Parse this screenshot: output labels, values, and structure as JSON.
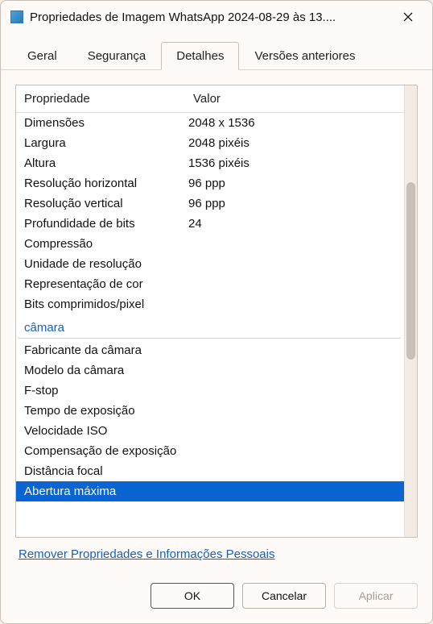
{
  "window": {
    "title": "Propriedades de Imagem WhatsApp 2024-08-29 às 13...."
  },
  "tabs": {
    "items": [
      {
        "label": "Geral"
      },
      {
        "label": "Segurança"
      },
      {
        "label": "Detalhes"
      },
      {
        "label": "Versões anteriores"
      }
    ],
    "active_index": 2
  },
  "grid": {
    "headers": {
      "property": "Propriedade",
      "value": "Valor"
    },
    "rows": [
      {
        "type": "row",
        "prop": "Dimensões",
        "val": "2048 x 1536"
      },
      {
        "type": "row",
        "prop": "Largura",
        "val": "2048 pixéis"
      },
      {
        "type": "row",
        "prop": "Altura",
        "val": "1536 pixéis"
      },
      {
        "type": "row",
        "prop": "Resolução horizontal",
        "val": "96 ppp"
      },
      {
        "type": "row",
        "prop": "Resolução vertical",
        "val": "96 ppp"
      },
      {
        "type": "row",
        "prop": "Profundidade de bits",
        "val": "24"
      },
      {
        "type": "row",
        "prop": "Compressão",
        "val": ""
      },
      {
        "type": "row",
        "prop": "Unidade de resolução",
        "val": ""
      },
      {
        "type": "row",
        "prop": "Representação de cor",
        "val": ""
      },
      {
        "type": "row",
        "prop": "Bits comprimidos/pixel",
        "val": ""
      },
      {
        "type": "section",
        "label": "câmara"
      },
      {
        "type": "row",
        "prop": "Fabricante da câmara",
        "val": ""
      },
      {
        "type": "row",
        "prop": "Modelo da câmara",
        "val": ""
      },
      {
        "type": "row",
        "prop": "F-stop",
        "val": ""
      },
      {
        "type": "row",
        "prop": "Tempo de exposição",
        "val": ""
      },
      {
        "type": "row",
        "prop": "Velocidade ISO",
        "val": ""
      },
      {
        "type": "row",
        "prop": "Compensação de exposição",
        "val": ""
      },
      {
        "type": "row",
        "prop": "Distância focal",
        "val": ""
      },
      {
        "type": "row",
        "prop": "Abertura máxima",
        "val": "",
        "selected": true
      }
    ]
  },
  "link": {
    "label": "Remover Propriedades e Informações Pessoais"
  },
  "buttons": {
    "ok": "OK",
    "cancel": "Cancelar",
    "apply": "Aplicar"
  }
}
